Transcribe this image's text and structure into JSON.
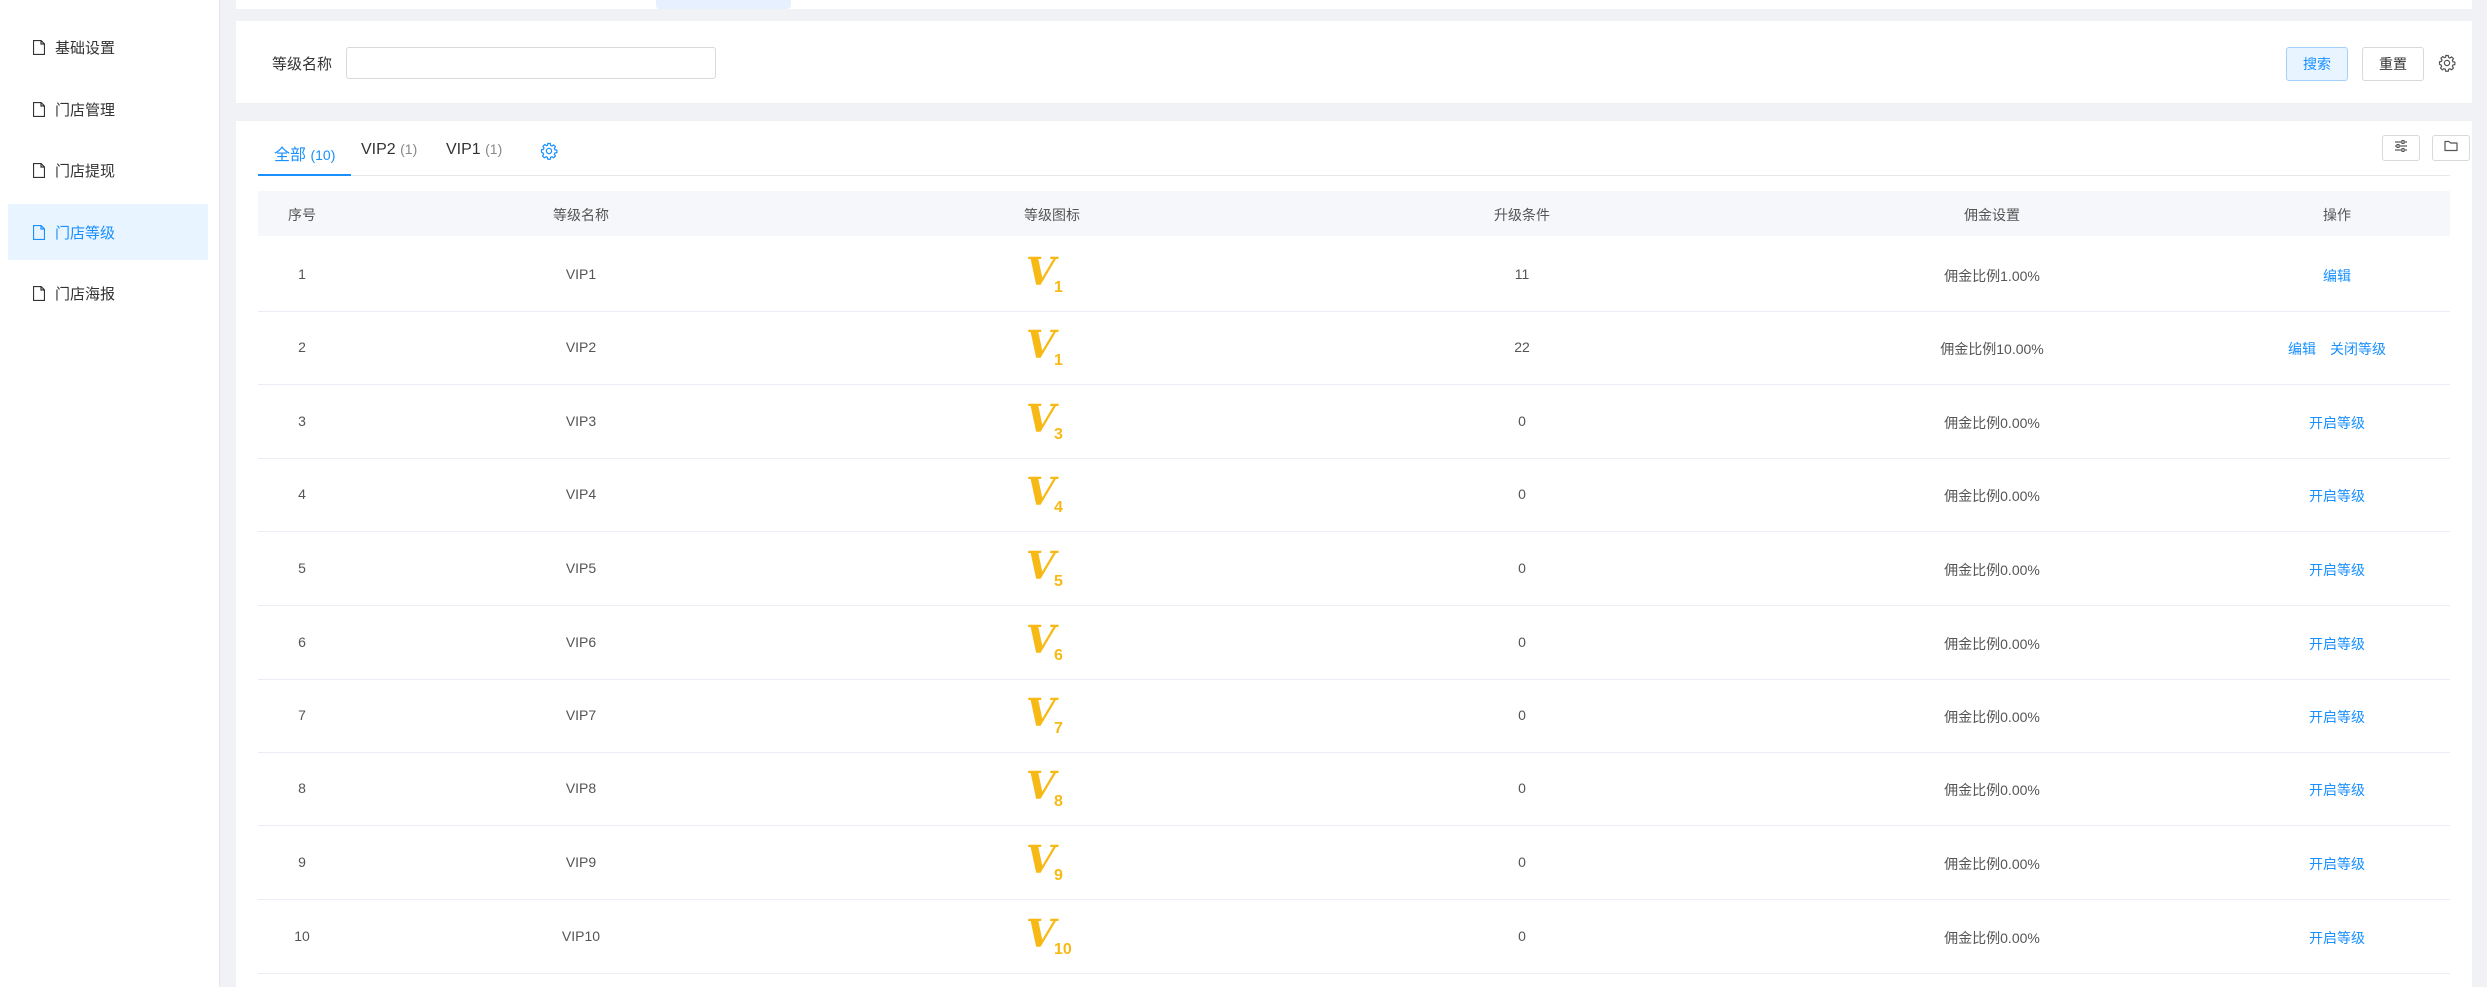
{
  "sidebar": {
    "items": [
      {
        "label": "基础设置",
        "active": false
      },
      {
        "label": "门店管理",
        "active": false
      },
      {
        "label": "门店提现",
        "active": false
      },
      {
        "label": "门店等级",
        "active": true
      },
      {
        "label": "门店海报",
        "active": false
      }
    ]
  },
  "search": {
    "label": "等级名称",
    "value": "",
    "search_button": "搜索",
    "reset_button": "重置"
  },
  "tabs": [
    {
      "label": "全部",
      "count": "(10)",
      "active": true
    },
    {
      "label": "VIP2",
      "count": "(1)",
      "active": false
    },
    {
      "label": "VIP1",
      "count": "(1)",
      "active": false
    }
  ],
  "table": {
    "columns": [
      "序号",
      "等级名称",
      "等级图标",
      "升级条件",
      "佣金设置",
      "操作"
    ],
    "rows": [
      {
        "index": "1",
        "name": "VIP1",
        "icon_num": "1",
        "condition": "11",
        "commission": "佣金比例1.00%",
        "actions": [
          "编辑"
        ]
      },
      {
        "index": "2",
        "name": "VIP2",
        "icon_num": "1",
        "condition": "22",
        "commission": "佣金比例10.00%",
        "actions": [
          "编辑",
          "关闭等级"
        ]
      },
      {
        "index": "3",
        "name": "VIP3",
        "icon_num": "3",
        "condition": "0",
        "commission": "佣金比例0.00%",
        "actions": [
          "开启等级"
        ]
      },
      {
        "index": "4",
        "name": "VIP4",
        "icon_num": "4",
        "condition": "0",
        "commission": "佣金比例0.00%",
        "actions": [
          "开启等级"
        ]
      },
      {
        "index": "5",
        "name": "VIP5",
        "icon_num": "5",
        "condition": "0",
        "commission": "佣金比例0.00%",
        "actions": [
          "开启等级"
        ]
      },
      {
        "index": "6",
        "name": "VIP6",
        "icon_num": "6",
        "condition": "0",
        "commission": "佣金比例0.00%",
        "actions": [
          "开启等级"
        ]
      },
      {
        "index": "7",
        "name": "VIP7",
        "icon_num": "7",
        "condition": "0",
        "commission": "佣金比例0.00%",
        "actions": [
          "开启等级"
        ]
      },
      {
        "index": "8",
        "name": "VIP8",
        "icon_num": "8",
        "condition": "0",
        "commission": "佣金比例0.00%",
        "actions": [
          "开启等级"
        ]
      },
      {
        "index": "9",
        "name": "VIP9",
        "icon_num": "9",
        "condition": "0",
        "commission": "佣金比例0.00%",
        "actions": [
          "开启等级"
        ]
      },
      {
        "index": "10",
        "name": "VIP10",
        "icon_num": "10",
        "condition": "0",
        "commission": "佣金比例0.00%",
        "actions": [
          "开启等级"
        ]
      }
    ]
  },
  "colors": {
    "accent": "#1890ff",
    "vip_icon": "#f7b916",
    "active_bg": "#e8f4ff"
  },
  "icons": {
    "sidebar_item": "document-icon",
    "settings": "gear-icon",
    "filter": "sliders-icon",
    "export": "folder-icon",
    "level": "vip-badge-icon"
  }
}
